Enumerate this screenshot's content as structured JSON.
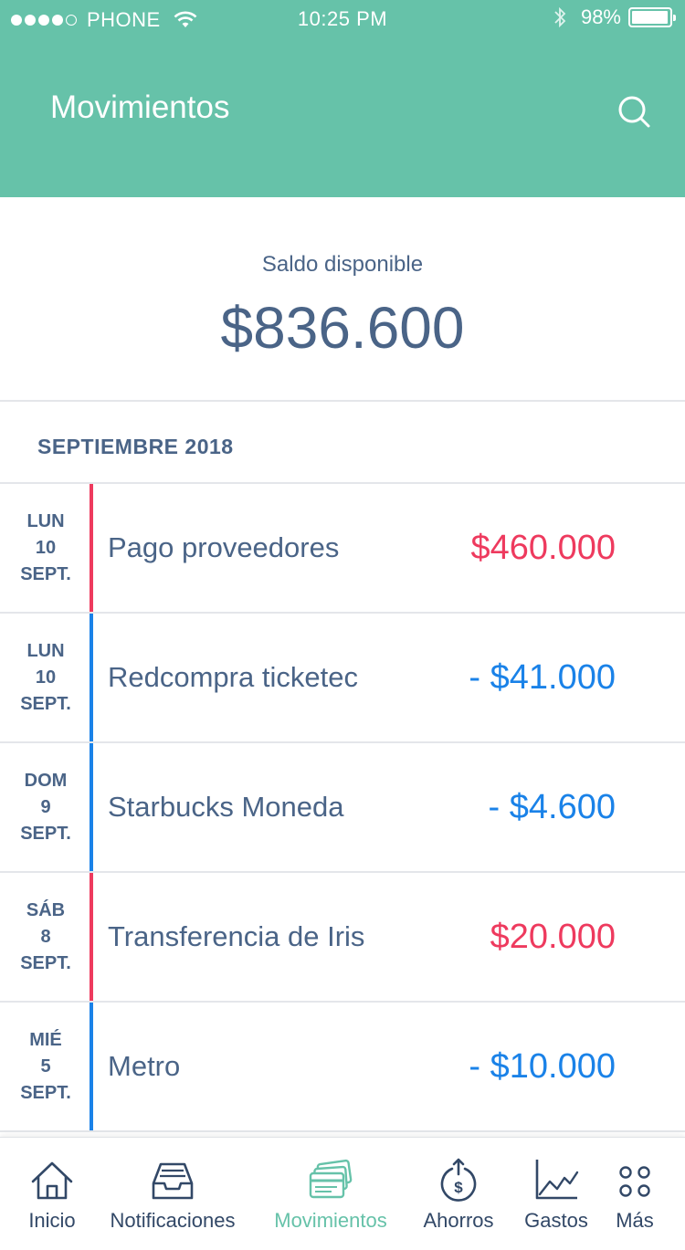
{
  "status_bar": {
    "carrier": "PHONE",
    "time": "10:25 PM",
    "battery_percent": "98%",
    "battery_level": 0.98
  },
  "header": {
    "title": "Movimientos",
    "search_icon": "search-icon"
  },
  "balance": {
    "label": "Saldo disponible",
    "value": "$836.600"
  },
  "month": "SEPTIEMBRE 2018",
  "transactions": [
    {
      "weekday": "LUN",
      "day": "10",
      "month": "SEPT.",
      "description": "Pago proveedores",
      "amount": "$460.000",
      "type": "income"
    },
    {
      "weekday": "LUN",
      "day": "10",
      "month": "SEPT.",
      "description": "Redcompra ticketec",
      "amount": "- $41.000",
      "type": "expense"
    },
    {
      "weekday": "DOM",
      "day": "9",
      "month": "SEPT.",
      "description": "Starbucks Moneda",
      "amount": "- $4.600",
      "type": "expense"
    },
    {
      "weekday": "SÁB",
      "day": "8",
      "month": "SEPT.",
      "description": "Transferencia de Iris",
      "amount": "$20.000",
      "type": "income"
    },
    {
      "weekday": "MIÉ",
      "day": "5",
      "month": "SEPT.",
      "description": "Metro",
      "amount": "- $10.000",
      "type": "expense"
    }
  ],
  "tabs": [
    {
      "label": "Inicio",
      "icon": "home-icon"
    },
    {
      "label": "Notificaciones",
      "icon": "inbox-icon"
    },
    {
      "label": "Movimientos",
      "icon": "cards-icon",
      "active": true
    },
    {
      "label": "Ahorros",
      "icon": "savings-icon"
    },
    {
      "label": "Gastos",
      "icon": "chart-icon"
    },
    {
      "label": "Más",
      "icon": "more-icon"
    }
  ],
  "colors": {
    "header_bg": "#66c2a9",
    "text": "#4a6487",
    "income": "#ee3a5e",
    "expense": "#1a82e8",
    "tab_active": "#66c2a9",
    "tab_inactive": "#324867"
  }
}
